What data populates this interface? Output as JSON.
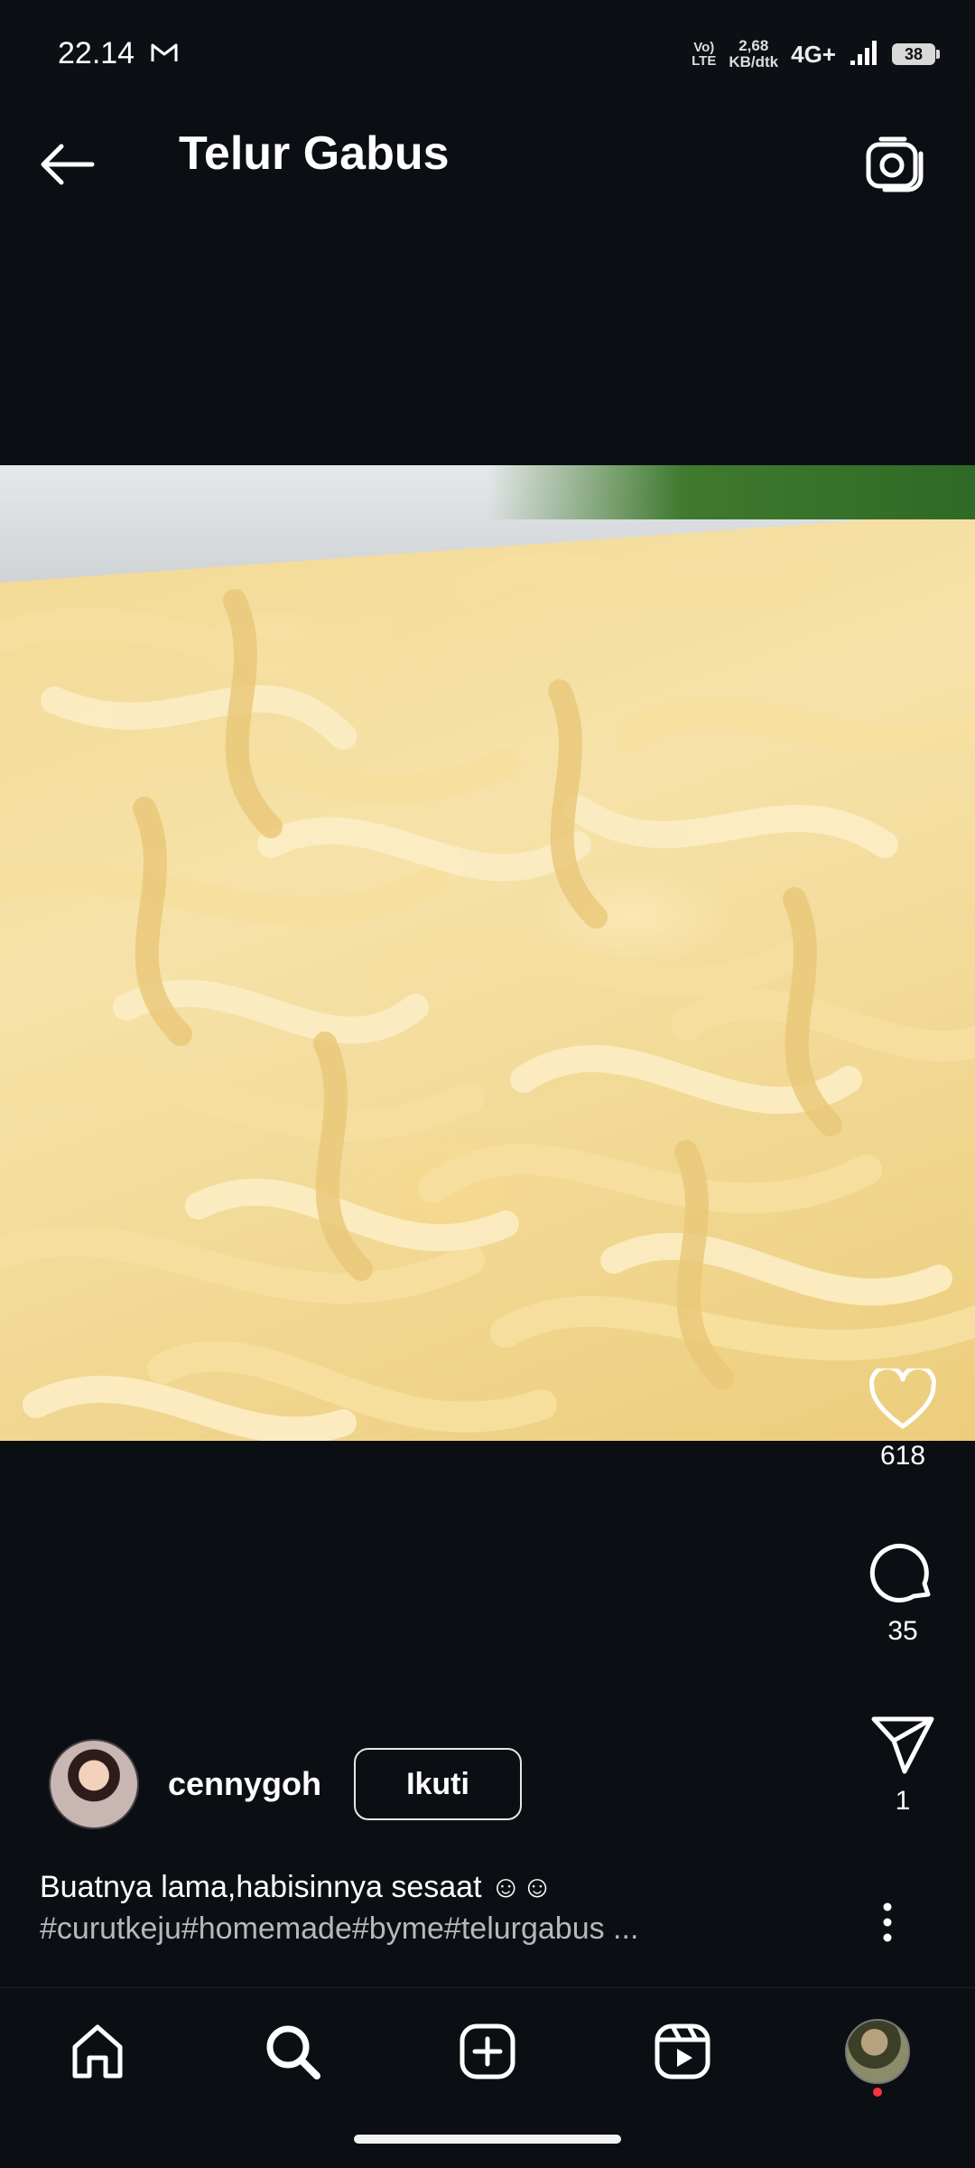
{
  "status_bar": {
    "time": "22.14",
    "volte_label_1": "Vo)",
    "volte_label_2": "LTE",
    "speed_value": "2,68",
    "speed_unit": "KB/dtk",
    "network": "4G+",
    "battery": "38",
    "icons": [
      "gmail-icon",
      "signal-icon"
    ]
  },
  "header": {
    "title": "Telur Gabus",
    "icons": [
      "back-arrow-icon",
      "camera-icon"
    ]
  },
  "actions": {
    "likes": "618",
    "comments": "35",
    "shares": "1",
    "icons": [
      "heart-icon",
      "comment-icon",
      "share-icon",
      "more-vertical-icon"
    ]
  },
  "author": {
    "username": "cennygoh",
    "follow_label": "Ikuti"
  },
  "caption": {
    "text": "Buatnya lama,habisinnya sesaat ☺☺",
    "hashtags": "#curutkeju#homemade#byme#telurgabus ..."
  },
  "bottom_nav": {
    "icons": [
      "home-icon",
      "search-icon",
      "create-icon",
      "reels-icon",
      "profile-avatar"
    ]
  },
  "colors": {
    "background": "#0b0e13",
    "text": "#ffffff",
    "muted_text": "#b6b8bb",
    "notification": "#ff3040"
  }
}
